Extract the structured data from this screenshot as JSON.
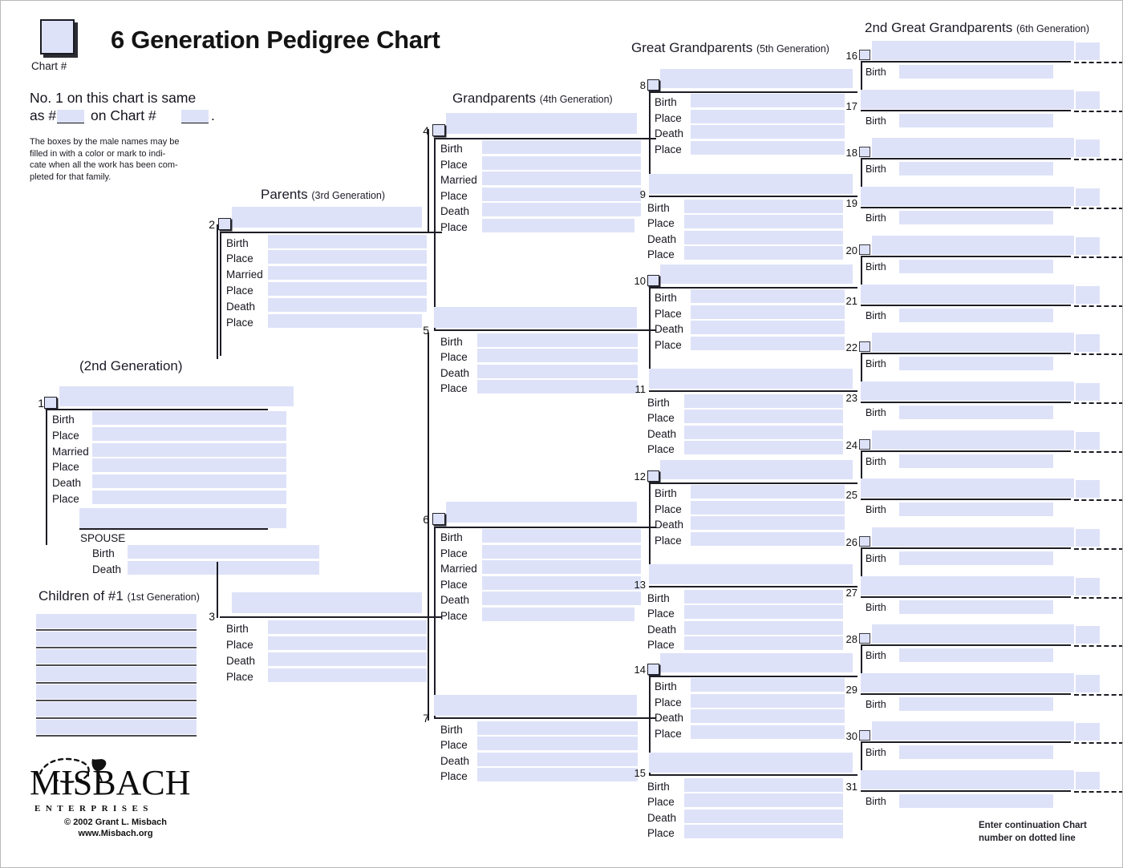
{
  "document": {
    "title": "6 Generation Pedigree Chart",
    "chart_number_label": "Chart #",
    "same_as_line1": "No. 1 on this chart is same",
    "same_as_line2_a": "as #",
    "same_as_line2_b": "on Chart #",
    "same_as_line2_c": ".",
    "note": "The boxes by the male names may be filled in with a color or mark to indi-cate when all the work has been completed for that family.",
    "note_lines": [
      "The boxes by the male names may be",
      "filled in with a color or mark to indi-",
      "cate when all the work has been com-",
      "pleted for that family."
    ],
    "continuation_note_lines": [
      "Enter continuation Chart",
      "number on dotted line"
    ],
    "footer": {
      "logo_word": "MISBACH",
      "logo_sub": "ENTERPRISES",
      "copyright": "© 2002 Grant L. Misbach",
      "website": "www.Misbach.org"
    }
  },
  "generations": {
    "g1": {
      "heading": "Children of #1",
      "sub": "(1st Generation)"
    },
    "g2": {
      "heading": "",
      "sub": "(2nd Generation)"
    },
    "g3": {
      "heading": "Parents",
      "sub": "(3rd Generation)"
    },
    "g4": {
      "heading": "Grandparents",
      "sub": "(4th Generation)"
    },
    "g5": {
      "heading": "Great Grandparents",
      "sub": "(5th Generation)"
    },
    "g6": {
      "heading": "2nd Great Grandparents",
      "sub": "(6th Generation)"
    }
  },
  "field_labels": {
    "birth": "Birth",
    "place": "Place",
    "married": "Married",
    "death": "Death",
    "spouse": "SPOUSE"
  },
  "person1": {
    "number": "1",
    "name": "",
    "rows": [
      "Birth",
      "Place",
      "Married",
      "Place",
      "Death",
      "Place"
    ],
    "spouse_label": "SPOUSE",
    "spouse_name": "",
    "spouse_rows": [
      "Birth",
      "Death"
    ]
  },
  "children": {
    "heading": "Children of #1",
    "sub": "(1st Generation)",
    "slots": [
      "",
      "",
      "",
      "",
      "",
      "",
      ""
    ]
  },
  "parents": [
    {
      "number": "2",
      "male": true,
      "name": "",
      "rows": [
        "Birth",
        "Place",
        "Married",
        "Place",
        "Death",
        "Place"
      ]
    },
    {
      "number": "3",
      "male": false,
      "name": "",
      "rows": [
        "Birth",
        "Place",
        "Death",
        "Place"
      ]
    }
  ],
  "grandparents": [
    {
      "number": "4",
      "male": true,
      "name": "",
      "rows": [
        "Birth",
        "Place",
        "Married",
        "Place",
        "Death",
        "Place"
      ]
    },
    {
      "number": "5",
      "male": false,
      "name": "",
      "rows": [
        "Birth",
        "Place",
        "Death",
        "Place"
      ]
    },
    {
      "number": "6",
      "male": true,
      "name": "",
      "rows": [
        "Birth",
        "Place",
        "Married",
        "Place",
        "Death",
        "Place"
      ]
    },
    {
      "number": "7",
      "male": false,
      "name": "",
      "rows": [
        "Birth",
        "Place",
        "Death",
        "Place"
      ]
    }
  ],
  "great_grandparents": [
    {
      "number": "8",
      "male": true,
      "name": "",
      "rows": [
        "Birth",
        "Place",
        "Death",
        "Place"
      ]
    },
    {
      "number": "9",
      "male": false,
      "name": "",
      "rows": [
        "Birth",
        "Place",
        "Death",
        "Place"
      ]
    },
    {
      "number": "10",
      "male": true,
      "name": "",
      "rows": [
        "Birth",
        "Place",
        "Death",
        "Place"
      ]
    },
    {
      "number": "11",
      "male": false,
      "name": "",
      "rows": [
        "Birth",
        "Place",
        "Death",
        "Place"
      ]
    },
    {
      "number": "12",
      "male": true,
      "name": "",
      "rows": [
        "Birth",
        "Place",
        "Death",
        "Place"
      ]
    },
    {
      "number": "13",
      "male": false,
      "name": "",
      "rows": [
        "Birth",
        "Place",
        "Death",
        "Place"
      ]
    },
    {
      "number": "14",
      "male": true,
      "name": "",
      "rows": [
        "Birth",
        "Place",
        "Death",
        "Place"
      ]
    },
    {
      "number": "15",
      "male": false,
      "name": "",
      "rows": [
        "Birth",
        "Place",
        "Death",
        "Place"
      ]
    }
  ],
  "second_great_grandparents": [
    {
      "number": "16",
      "male": true,
      "name": "",
      "birth_label": "Birth",
      "birth": "",
      "cont_chart": ""
    },
    {
      "number": "17",
      "male": false,
      "name": "",
      "birth_label": "Birth",
      "birth": "",
      "cont_chart": ""
    },
    {
      "number": "18",
      "male": true,
      "name": "",
      "birth_label": "Birth",
      "birth": "",
      "cont_chart": ""
    },
    {
      "number": "19",
      "male": false,
      "name": "",
      "birth_label": "Birth",
      "birth": "",
      "cont_chart": ""
    },
    {
      "number": "20",
      "male": true,
      "name": "",
      "birth_label": "Birth",
      "birth": "",
      "cont_chart": ""
    },
    {
      "number": "21",
      "male": false,
      "name": "",
      "birth_label": "Birth",
      "birth": "",
      "cont_chart": ""
    },
    {
      "number": "22",
      "male": true,
      "name": "",
      "birth_label": "Birth",
      "birth": "",
      "cont_chart": ""
    },
    {
      "number": "23",
      "male": false,
      "name": "",
      "birth_label": "Birth",
      "birth": "",
      "cont_chart": ""
    },
    {
      "number": "24",
      "male": true,
      "name": "",
      "birth_label": "Birth",
      "birth": "",
      "cont_chart": ""
    },
    {
      "number": "25",
      "male": false,
      "name": "",
      "birth_label": "Birth",
      "birth": "",
      "cont_chart": ""
    },
    {
      "number": "26",
      "male": true,
      "name": "",
      "birth_label": "Birth",
      "birth": "",
      "cont_chart": ""
    },
    {
      "number": "27",
      "male": false,
      "name": "",
      "birth_label": "Birth",
      "birth": "",
      "cont_chart": ""
    },
    {
      "number": "28",
      "male": true,
      "name": "",
      "birth_label": "Birth",
      "birth": "",
      "cont_chart": ""
    },
    {
      "number": "29",
      "male": false,
      "name": "",
      "birth_label": "Birth",
      "birth": "",
      "cont_chart": ""
    },
    {
      "number": "30",
      "male": true,
      "name": "",
      "birth_label": "Birth",
      "birth": "",
      "cont_chart": ""
    },
    {
      "number": "31",
      "male": false,
      "name": "",
      "birth_label": "Birth",
      "birth": "",
      "cont_chart": ""
    }
  ],
  "colors": {
    "field_fill": "#dee2f8",
    "stroke": "#1d1d26",
    "text": "#14141e",
    "page_border": "#b9b9b9"
  }
}
